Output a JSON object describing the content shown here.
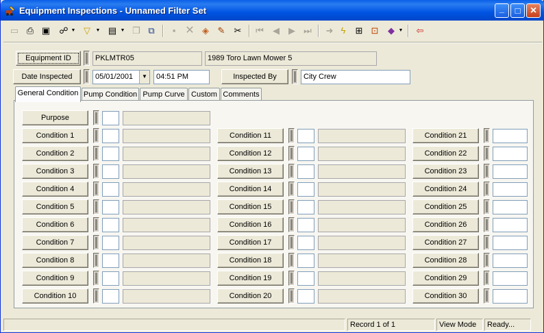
{
  "window": {
    "title": "Equipment Inspections - Unnamed Filter Set",
    "title_icon": "inspection-app-icon",
    "controls": {
      "minimize": "_",
      "maximize": "□",
      "close": "×"
    }
  },
  "toolbar": {
    "icons": [
      "new-record-icon",
      "print-icon",
      "print-preview-icon",
      "binoculars-find-icon",
      "filter-icon",
      "report-icon",
      "copy-icon",
      "duplicate-icon",
      "save-icon",
      "delete-icon",
      "attach-icon",
      "edit-icon",
      "cut-icon",
      "first-record-icon",
      "previous-record-icon",
      "next-record-icon",
      "last-record-icon",
      "go-icon",
      "quick-action-icon",
      "zoom-icon",
      "tree-icon",
      "books-icon",
      "exit-icon"
    ]
  },
  "header": {
    "equipment_id_label": "Equipment ID",
    "equipment_id_value": "PKLMTR05",
    "equipment_desc_value": "1989 Toro Lawn Mower 5",
    "date_inspected_label": "Date Inspected",
    "date_value": "05/01/2001",
    "time_value": "04:51 PM",
    "inspected_by_label": "Inspected By",
    "inspected_by_value": "City Crew"
  },
  "tabs": [
    {
      "label": "General Condition",
      "active": true
    },
    {
      "label": "Pump Condition",
      "active": false
    },
    {
      "label": "Pump Curve",
      "active": false
    },
    {
      "label": "Custom",
      "active": false
    },
    {
      "label": "Comments",
      "active": false
    }
  ],
  "general": {
    "purpose_label": "Purpose",
    "col1": [
      "Condition 1",
      "Condition 2",
      "Condition 3",
      "Condition 4",
      "Condition 5",
      "Condition 6",
      "Condition 7",
      "Condition 8",
      "Condition 9",
      "Condition 10"
    ],
    "col2": [
      "Condition 11",
      "Condition 12",
      "Condition 13",
      "Condition 14",
      "Condition 15",
      "Condition 16",
      "Condition 17",
      "Condition 18",
      "Condition 19",
      "Condition 20"
    ],
    "col3": [
      "Condition 21",
      "Condition 22",
      "Condition 23",
      "Condition 24",
      "Condition 25",
      "Condition 26",
      "Condition 27",
      "Condition 28",
      "Condition 29",
      "Condition 30"
    ]
  },
  "status": {
    "blank": "",
    "record": "Record 1 of 1",
    "mode": "View Mode",
    "state": "Ready..."
  }
}
